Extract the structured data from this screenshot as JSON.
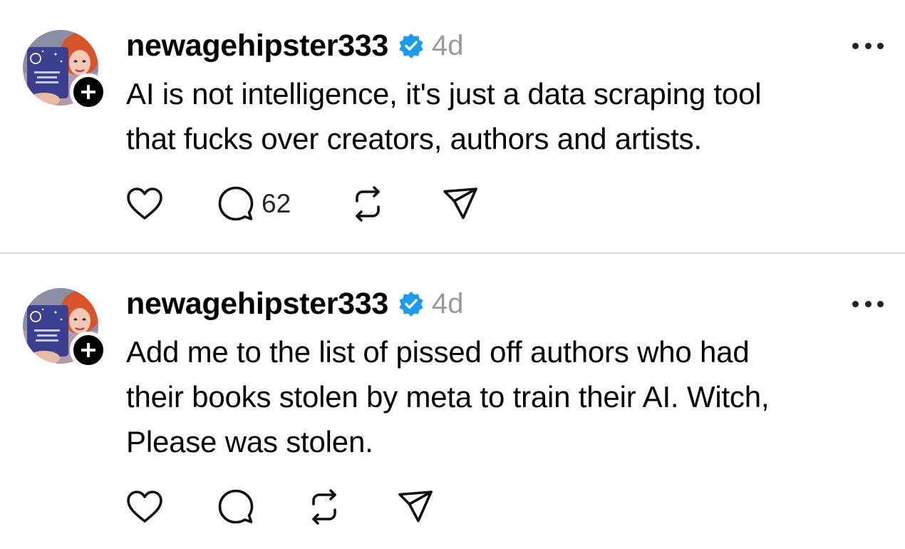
{
  "colors": {
    "verified_badge": "#1d9bf0",
    "timestamp_gray": "#999999",
    "divider": "#dcdcdc",
    "text": "#000000"
  },
  "icons": {
    "like": "heart-outline-icon",
    "reply": "speech-bubble-icon",
    "repost": "repost-arrows-icon",
    "share": "paper-plane-icon",
    "more": "more-dots-icon",
    "follow": "plus-icon",
    "verified": "verified-check-icon"
  },
  "posts": [
    {
      "username": "newagehipster333",
      "time": "4d",
      "text_lines": [
        "AI is not intelligence, it's just a data scraping tool",
        "that fucks over creators, authors and artists."
      ],
      "reply_count": "62"
    },
    {
      "username": "newagehipster333",
      "time": "4d",
      "text_lines": [
        "Add me to the list of pissed off authors who had",
        "their books stolen by meta to train their AI. Witch,",
        "Please was stolen."
      ],
      "reply_count": ""
    }
  ]
}
